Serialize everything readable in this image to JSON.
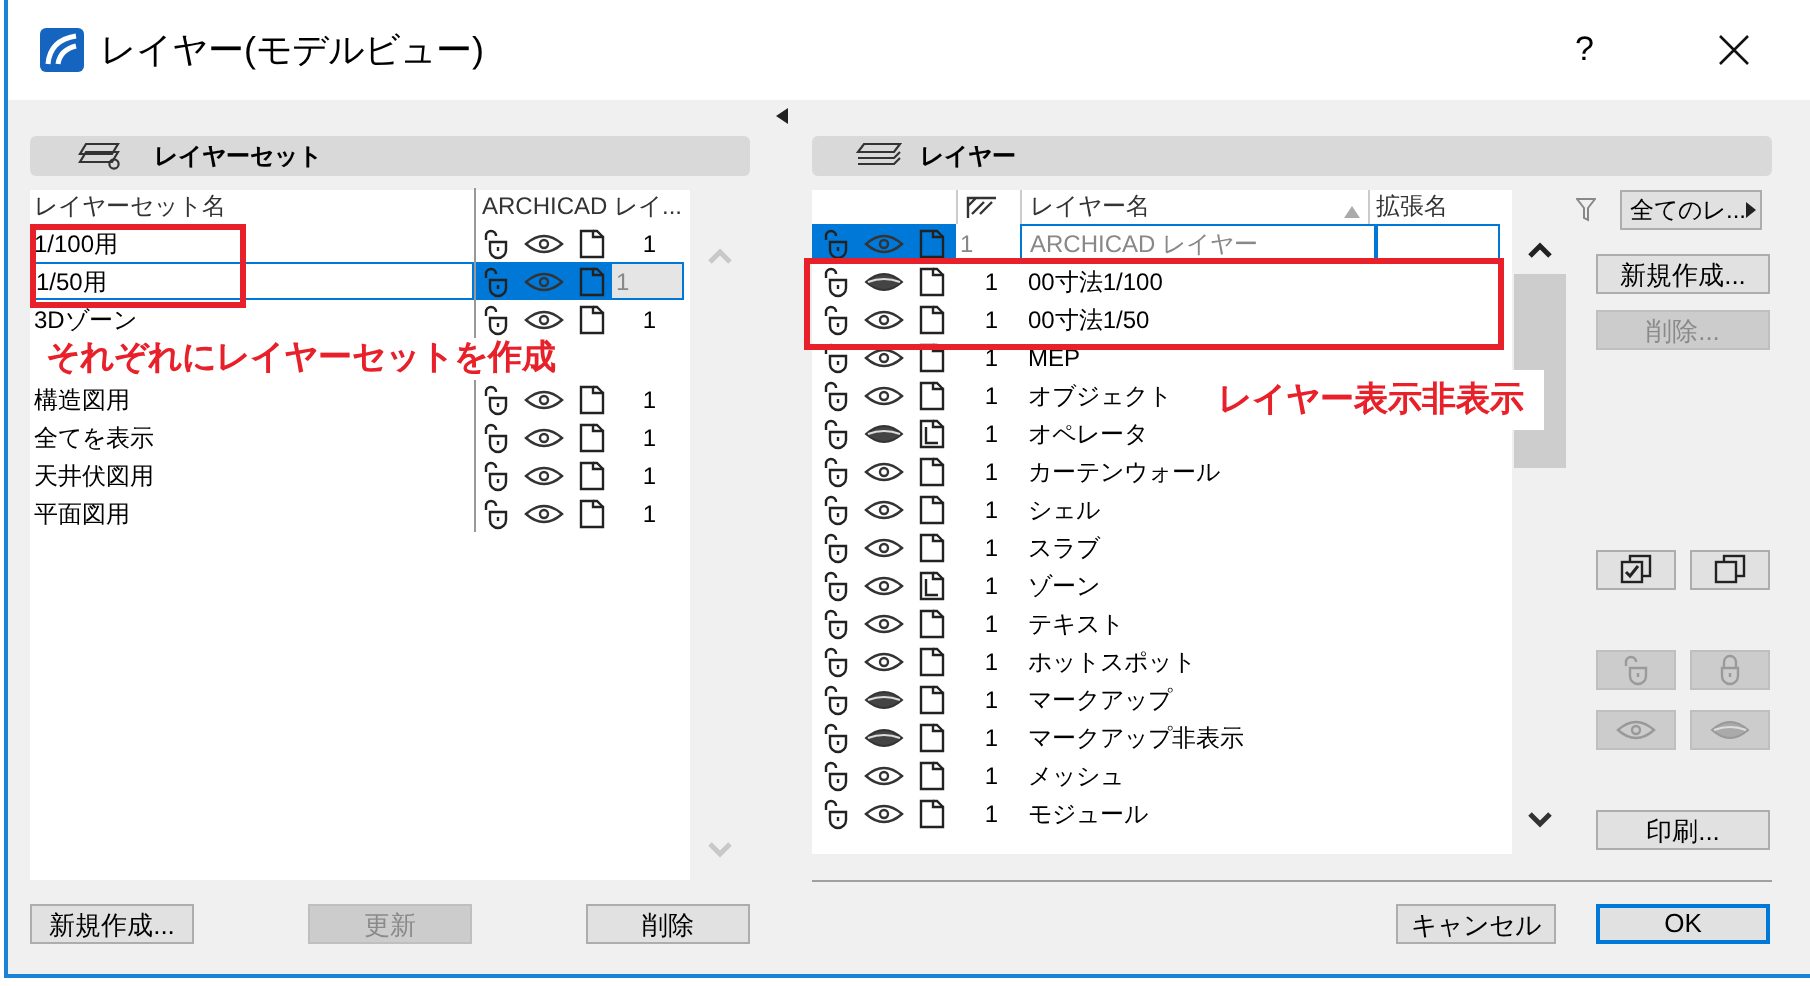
{
  "window": {
    "title": "レイヤー(モデルビュー)",
    "help": "?"
  },
  "layer_sets": {
    "header": "レイヤーセット",
    "columns": [
      "レイヤーセット名",
      "ARCHICAD レイ..."
    ],
    "rows": [
      {
        "kind": "row",
        "name": "1/100用",
        "number": "1",
        "selected": false
      },
      {
        "kind": "row",
        "name": "1/50用",
        "number": "1",
        "selected": true
      },
      {
        "kind": "row",
        "name": "3Dゾーン",
        "number": "1",
        "selected": false
      },
      {
        "kind": "annotation",
        "text": "それぞれにレイヤーセットを作成"
      },
      {
        "kind": "row",
        "name": "構造図用",
        "number": "1",
        "selected": false
      },
      {
        "kind": "row",
        "name": "全てを表示",
        "number": "1",
        "selected": false
      },
      {
        "kind": "row",
        "name": "天井伏図用",
        "number": "1",
        "selected": false
      },
      {
        "kind": "row",
        "name": "平面図用",
        "number": "1",
        "selected": false
      }
    ],
    "buttons": [
      {
        "label": "新規作成...",
        "disabled": false
      },
      {
        "label": "更新",
        "disabled": true
      },
      {
        "label": "削除",
        "disabled": false
      }
    ]
  },
  "layers": {
    "header": "レイヤー",
    "columns": [
      "レイヤー名",
      "拡張名"
    ],
    "filter": "全てのレ...",
    "rows": [
      {
        "name": "ARCHICAD レイヤー",
        "number": "1",
        "visible": true,
        "wireframe": false,
        "selected": true
      },
      {
        "name": "00寸法1/100",
        "number": "1",
        "visible": false,
        "wireframe": false,
        "selected": false
      },
      {
        "name": "00寸法1/50",
        "number": "1",
        "visible": true,
        "wireframe": false,
        "selected": false
      },
      {
        "name": "MEP",
        "number": "1",
        "visible": true,
        "wireframe": false,
        "selected": false
      },
      {
        "name": "オブジェクト",
        "number": "1",
        "visible": true,
        "wireframe": false,
        "selected": false
      },
      {
        "name": "オペレータ",
        "number": "1",
        "visible": false,
        "wireframe": true,
        "selected": false
      },
      {
        "name": "カーテンウォール",
        "number": "1",
        "visible": true,
        "wireframe": false,
        "selected": false
      },
      {
        "name": "シェル",
        "number": "1",
        "visible": true,
        "wireframe": false,
        "selected": false
      },
      {
        "name": "スラブ",
        "number": "1",
        "visible": true,
        "wireframe": false,
        "selected": false
      },
      {
        "name": "ゾーン",
        "number": "1",
        "visible": true,
        "wireframe": true,
        "selected": false
      },
      {
        "name": "テキスト",
        "number": "1",
        "visible": true,
        "wireframe": false,
        "selected": false
      },
      {
        "name": "ホットスポット",
        "number": "1",
        "visible": true,
        "wireframe": false,
        "selected": false
      },
      {
        "name": "マークアップ",
        "number": "1",
        "visible": false,
        "wireframe": false,
        "selected": false
      },
      {
        "name": "マークアップ非表示",
        "number": "1",
        "visible": false,
        "wireframe": false,
        "selected": false
      },
      {
        "name": "メッシュ",
        "number": "1",
        "visible": true,
        "wireframe": false,
        "selected": false
      },
      {
        "name": "モジュール",
        "number": "1",
        "visible": true,
        "wireframe": false,
        "selected": false
      }
    ],
    "annotation": "レイヤー表示非表示",
    "buttons": [
      {
        "label": "新規作成...",
        "disabled": false
      },
      {
        "label": "削除...",
        "disabled": true
      }
    ],
    "icon_buttons": [
      {
        "kind": "check-stack",
        "disabled": false
      },
      {
        "kind": "stack",
        "disabled": false
      },
      {
        "kind": "unlock",
        "disabled": true
      },
      {
        "kind": "lock",
        "disabled": true
      },
      {
        "kind": "eye",
        "disabled": true
      },
      {
        "kind": "eye-closed",
        "disabled": true
      }
    ],
    "print": "印刷..."
  },
  "footer": {
    "cancel": "キャンセル",
    "ok": "OK"
  }
}
